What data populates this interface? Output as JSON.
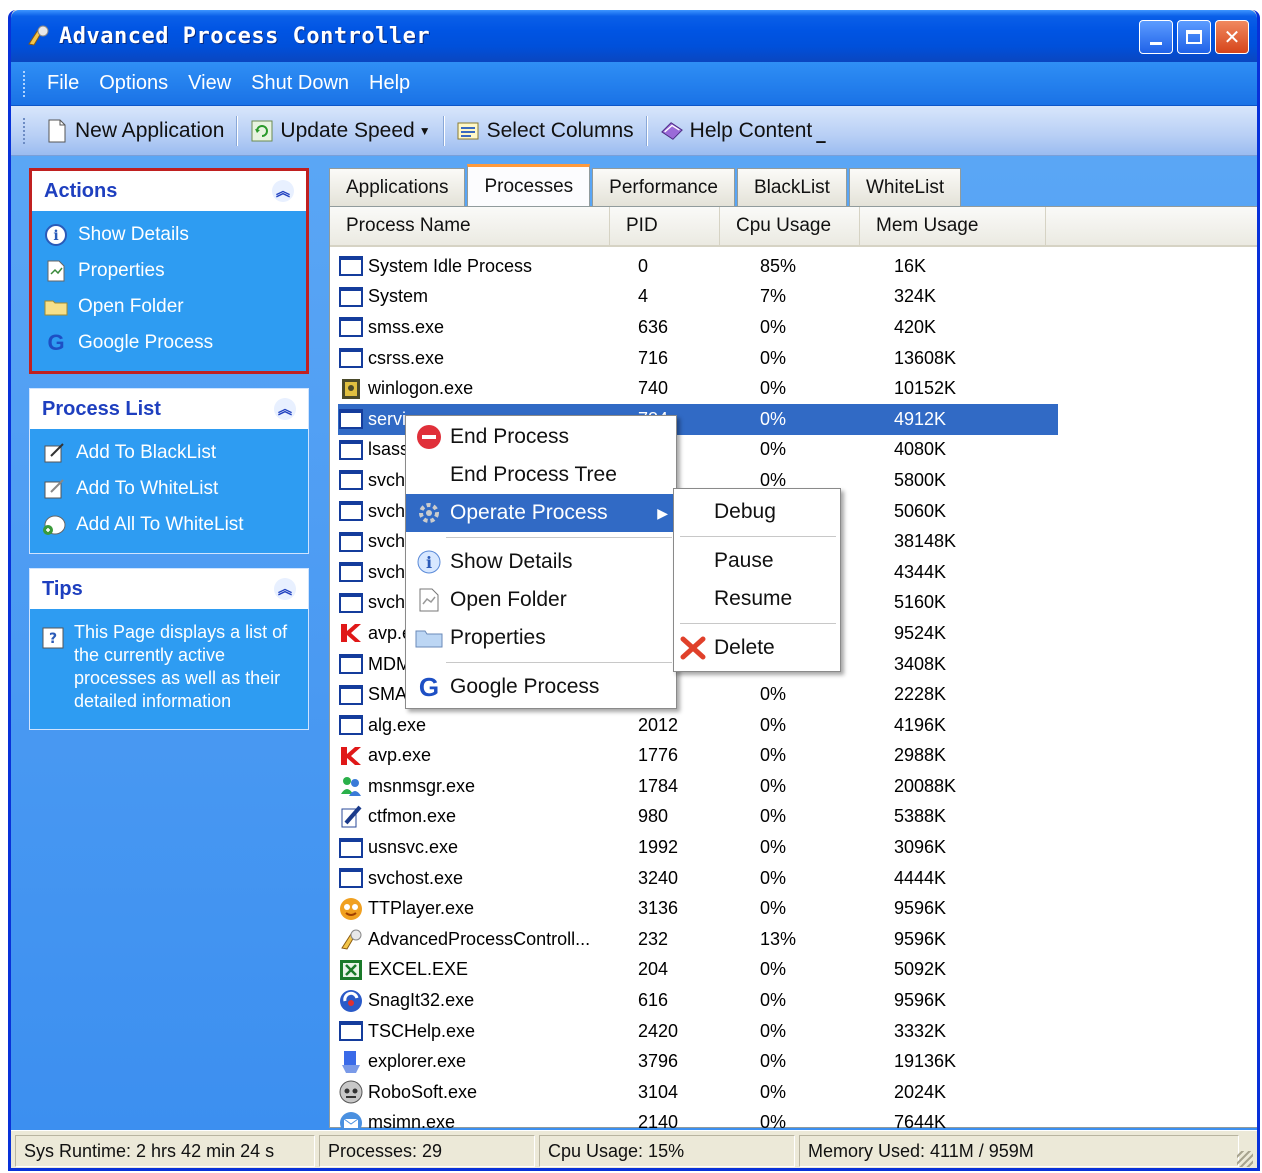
{
  "window": {
    "title": "Advanced Process Controller"
  },
  "menubar": [
    "File",
    "Options",
    "View",
    "Shut Down",
    "Help"
  ],
  "toolbar": {
    "new_app": "New Application",
    "update_speed": "Update Speed",
    "select_columns": "Select Columns",
    "help_content": "Help Content"
  },
  "actions": {
    "title": "Actions",
    "items": [
      "Show Details",
      "Properties",
      "Open Folder",
      "Google Process"
    ]
  },
  "process_list": {
    "title": "Process List",
    "items": [
      "Add To BlackList",
      "Add To WhiteList",
      "Add All To WhiteList"
    ]
  },
  "tips": {
    "title": "Tips",
    "text": "This Page displays a list of the currently active processes as well as their detailed information"
  },
  "tabs": [
    "Applications",
    "Processes",
    "Performance",
    "BlackList",
    "WhiteList"
  ],
  "columns": [
    "Process Name",
    "PID",
    "Cpu Usage",
    "Mem Usage"
  ],
  "rows": [
    {
      "name": "System Idle Process",
      "pid": "0",
      "cpu": "85%",
      "mem": "16K",
      "icon": "window"
    },
    {
      "name": "System",
      "pid": "4",
      "cpu": "7%",
      "mem": "324K",
      "icon": "window"
    },
    {
      "name": "smss.exe",
      "pid": "636",
      "cpu": "0%",
      "mem": "420K",
      "icon": "window"
    },
    {
      "name": "csrss.exe",
      "pid": "716",
      "cpu": "0%",
      "mem": "13608K",
      "icon": "window"
    },
    {
      "name": "winlogon.exe",
      "pid": "740",
      "cpu": "0%",
      "mem": "10152K",
      "icon": "lock"
    },
    {
      "name": "services.exe",
      "pid": "784",
      "cpu": "0%",
      "mem": "4912K",
      "icon": "window"
    },
    {
      "name": "lsass.exe",
      "pid": "",
      "cpu": "0%",
      "mem": "4080K",
      "icon": "window"
    },
    {
      "name": "svchost.exe",
      "pid": "",
      "cpu": "0%",
      "mem": "5800K",
      "icon": "window"
    },
    {
      "name": "svchost.exe",
      "pid": "",
      "cpu": "",
      "mem": "5060K",
      "icon": "window"
    },
    {
      "name": "svchost.exe",
      "pid": "",
      "cpu": "",
      "mem": "38148K",
      "icon": "window"
    },
    {
      "name": "svchost.exe",
      "pid": "",
      "cpu": "",
      "mem": "4344K",
      "icon": "window"
    },
    {
      "name": "svchost.exe",
      "pid": "",
      "cpu": "",
      "mem": "5160K",
      "icon": "window"
    },
    {
      "name": "avp.exe",
      "pid": "",
      "cpu": "",
      "mem": "9524K",
      "icon": "avp"
    },
    {
      "name": "MDM.EXE",
      "pid": "",
      "cpu": "",
      "mem": "3408K",
      "icon": "window"
    },
    {
      "name": "SMAgent.exe",
      "pid": "",
      "cpu": "0%",
      "mem": "2228K",
      "icon": "window"
    },
    {
      "name": "alg.exe",
      "pid": "2012",
      "cpu": "0%",
      "mem": "4196K",
      "icon": "window"
    },
    {
      "name": "avp.exe",
      "pid": "1776",
      "cpu": "0%",
      "mem": "2988K",
      "icon": "avp"
    },
    {
      "name": "msnmsgr.exe",
      "pid": "1784",
      "cpu": "0%",
      "mem": "20088K",
      "icon": "msn"
    },
    {
      "name": "ctfmon.exe",
      "pid": "980",
      "cpu": "0%",
      "mem": "5388K",
      "icon": "pen"
    },
    {
      "name": "usnsvc.exe",
      "pid": "1992",
      "cpu": "0%",
      "mem": "3096K",
      "icon": "window"
    },
    {
      "name": "svchost.exe",
      "pid": "3240",
      "cpu": "0%",
      "mem": "4444K",
      "icon": "window"
    },
    {
      "name": "TTPlayer.exe",
      "pid": "3136",
      "cpu": "0%",
      "mem": "9596K",
      "icon": "ttplayer"
    },
    {
      "name": "AdvancedProcessControll...",
      "pid": "232",
      "cpu": "13%",
      "mem": "9596K",
      "icon": "apc"
    },
    {
      "name": "EXCEL.EXE",
      "pid": "204",
      "cpu": "0%",
      "mem": "5092K",
      "icon": "excel"
    },
    {
      "name": "SnagIt32.exe",
      "pid": "616",
      "cpu": "0%",
      "mem": "9596K",
      "icon": "snagit"
    },
    {
      "name": "TSCHelp.exe",
      "pid": "2420",
      "cpu": "0%",
      "mem": "3332K",
      "icon": "window"
    },
    {
      "name": "explorer.exe",
      "pid": "3796",
      "cpu": "0%",
      "mem": "19136K",
      "icon": "explorer"
    },
    {
      "name": "RoboSoft.exe",
      "pid": "3104",
      "cpu": "0%",
      "mem": "2024K",
      "icon": "robo"
    },
    {
      "name": "msimn.exe",
      "pid": "2140",
      "cpu": "0%",
      "mem": "7644K",
      "icon": "mail"
    }
  ],
  "selected_row": 5,
  "context_menu": {
    "items": [
      "End Process",
      "End Process Tree",
      "Operate Process",
      "Show Details",
      "Open Folder",
      "Properties",
      "Google Process"
    ]
  },
  "submenu": {
    "items": [
      "Debug",
      "Pause",
      "Resume",
      "Delete"
    ]
  },
  "status": {
    "runtime": "Sys Runtime: 2 hrs 42 min 24 s",
    "processes": "Processes: 29",
    "cpu": "Cpu Usage: 15%",
    "memory": "Memory Used: 411M / 959M"
  }
}
